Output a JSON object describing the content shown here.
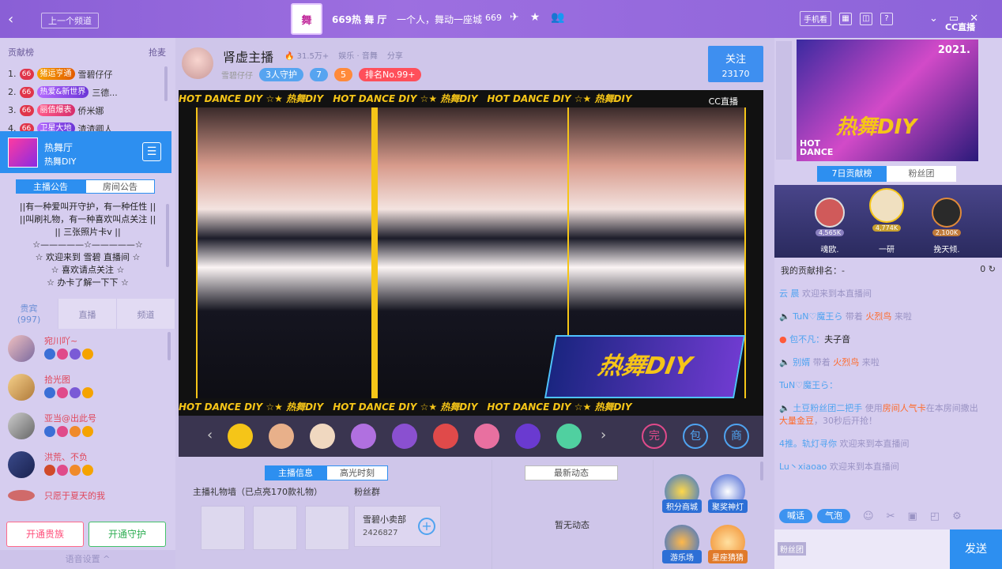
{
  "topbar": {
    "back_icon": "‹",
    "prev_channel": "上一个频道",
    "room_logo": "舞",
    "room_title": "669热 舞 厅",
    "slogan": "一个人，舞动一座城",
    "room_id": "669",
    "phone_view": "手机看",
    "brand": "CC直播",
    "help": "?"
  },
  "left": {
    "rank_title": "贡献榜",
    "rank_action": "抢麦",
    "rank_rows": [
      {
        "n": "1.",
        "badge": "猪运亨通",
        "name": "雪碧仔仔"
      },
      {
        "n": "2.",
        "badge": "热爱&新世界",
        "name": "三德..."
      },
      {
        "n": "3.",
        "badge": "丽值爆表",
        "name": "侨米娜"
      },
      {
        "n": "4.",
        "badge": "卫星大地",
        "name": "渣渣卿人"
      }
    ],
    "room_card": {
      "title": "热舞厅",
      "sub": "热舞DIY"
    },
    "notice_tabs": [
      "主播公告",
      "房间公告"
    ],
    "notice_lines": [
      "||有一种爱叫开守护，有一种任性 ||",
      "||叫刷礼物，有一种喜欢叫点关注 ||",
      "||                三张照片卡v              ||",
      "☆—————☆—————☆",
      "☆       欢迎来到 雪碧 直播间        ☆",
      "☆              喜欢请点关注              ☆",
      "☆              办卡了解一下下            ☆"
    ],
    "viewer_tabs": [
      {
        "label": "贵宾",
        "count": "(997)"
      },
      {
        "label": "直播"
      },
      {
        "label": "频道"
      }
    ],
    "viewers": [
      "宛川吖~",
      "拾光图",
      "亚当@出此号",
      "洪荒、不负",
      "只愿于夏天的我"
    ],
    "open_noble": "开通贵族",
    "open_guard": "开通守护",
    "bottom_settings": "语音设置 ^"
  },
  "center": {
    "anchor_name": "肾虚主播",
    "popularity": "31.5万+",
    "tag_dance": "娱乐 · 音舞",
    "share": "分享",
    "sub_name": "雪碧仔仔",
    "guards": "3人守护",
    "fans_count": "7",
    "stars": "5",
    "rank": "排名No.99+",
    "follow": "关注",
    "follow_count": "23170",
    "banner_text": "HOT DANCE DIY ☆★ 热舞DIY",
    "watermark": "CC直播",
    "dance_logo": "热舞DIY",
    "info_tabs": [
      "主播信息",
      "高光时刻"
    ],
    "gift_wall": "主播礼物墙（已点亮170款礼物）",
    "fans_group": "粉丝群",
    "fans_card": {
      "name": "雪碧小卖部",
      "id": "2426827"
    },
    "news_tab": "最新动态",
    "news_empty": "暂无动态",
    "apps": [
      "积分商城",
      "聚奖神灯",
      "游乐场",
      "星座猜猜"
    ]
  },
  "right": {
    "poster": {
      "year": "2021.",
      "title": "热舞DIY",
      "hot": "HOT",
      "dance": "DANCE"
    },
    "tabs": [
      "7日贡献榜",
      "粉丝团"
    ],
    "podium": [
      {
        "name": "魂欧.",
        "value": "4,565K"
      },
      {
        "name": "一研",
        "value": "4,774K"
      },
      {
        "name": "挽天倾.",
        "value": "2,100K"
      }
    ],
    "my_rank_label": "我的贡献排名：",
    "my_rank_value": "-",
    "my_rank_count": "0",
    "messages": [
      {
        "user": "云    晨",
        "text": "欢迎来到本直播间"
      },
      {
        "user": "TuN♡魔王ら",
        "pre": "带着",
        "gift": "火烈鸟",
        "post": "来啦"
      },
      {
        "user": "包不凡：",
        "text": "夫子音"
      },
      {
        "user": "别婿",
        "pre": "带着",
        "gift": "火烈鸟",
        "post": "来啦"
      },
      {
        "user": "TuN♡魔王ら："
      },
      {
        "user": "土豆粉丝团二把手",
        "pre": "使用",
        "gift": "房间人气卡",
        "post": "在本房间撒出",
        "gift2": "大量金豆",
        "post2": "，30秒后开抢！"
      },
      {
        "user": "4推。轨灯寻你",
        "text": "欢迎来到本直播间"
      },
      {
        "user": "Lu丶xiaoao",
        "text": "欢迎来到本直播间"
      }
    ],
    "tool_talk": "喊话",
    "tool_bubble": "气泡",
    "fans_tag": "粉丝团",
    "send": "发送"
  }
}
